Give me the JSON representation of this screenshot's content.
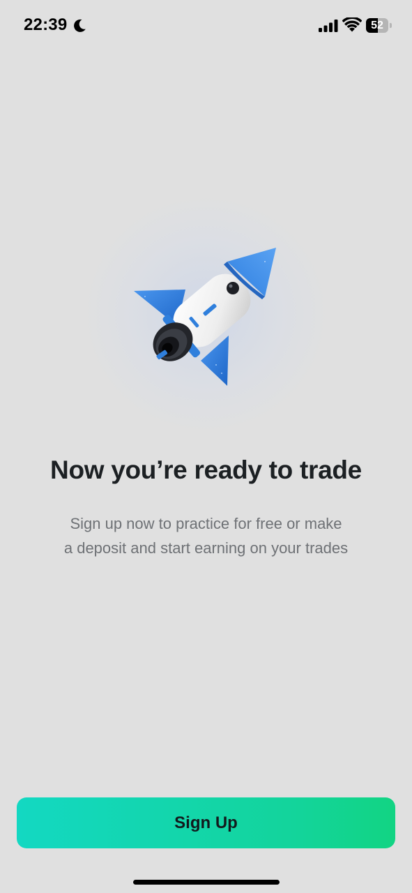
{
  "status_bar": {
    "time": "22:39",
    "battery_level": "52",
    "icons": [
      "moon-icon",
      "signal-icon",
      "wifi-icon",
      "battery-icon"
    ]
  },
  "onboarding": {
    "illustration": "rocket-icon",
    "title": "Now you’re ready to trade",
    "subtitle_line1": "Sign up now to practice for free or make",
    "subtitle_line2": "a deposit and start earning on your trades"
  },
  "actions": {
    "signup_label": "Sign Up"
  },
  "colors": {
    "background": "#e0e0e0",
    "button_gradient_start": "#13d8c2",
    "button_gradient_end": "#12d483",
    "rocket_blue": "#2f7fdc",
    "rocket_body": "#f0f0f0"
  }
}
